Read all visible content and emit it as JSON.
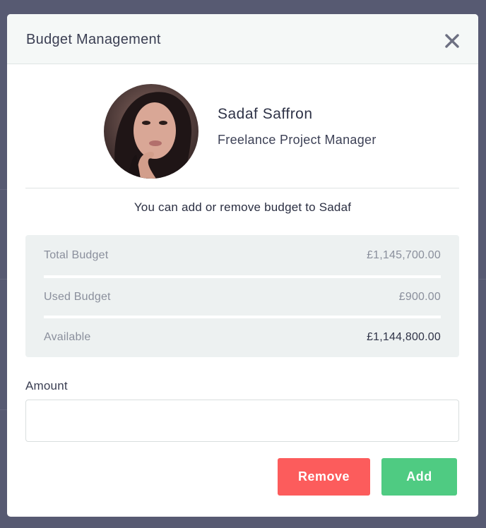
{
  "modal": {
    "title": "Budget Management",
    "close_icon": "close-icon"
  },
  "profile": {
    "name": "Sadaf Saffron",
    "role": "Freelance Project Manager",
    "avatar_icon": "avatar-photo"
  },
  "notice": "You can add or remove budget to Sadaf",
  "budget": {
    "rows": [
      {
        "label": "Total Budget",
        "value": "£1,145,700.00"
      },
      {
        "label": "Used Budget",
        "value": "£900.00"
      },
      {
        "label": "Available",
        "value": "£1,144,800.00"
      }
    ]
  },
  "amount": {
    "label": "Amount",
    "value": "",
    "placeholder": ""
  },
  "actions": {
    "remove_label": "Remove",
    "add_label": "Add"
  },
  "colors": {
    "overlay": "#575a72",
    "remove": "#fc5c5c",
    "add": "#4fcb82",
    "budget_box": "#edf1f1"
  }
}
